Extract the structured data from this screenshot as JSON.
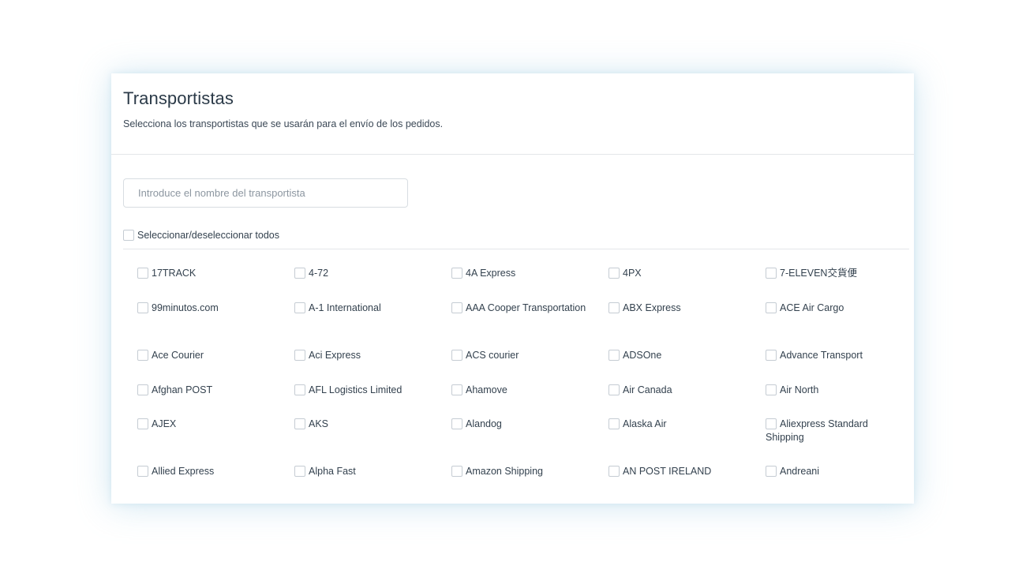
{
  "header": {
    "title": "Transportistas",
    "subtitle": "Selecciona los transportistas que se usarán para el envío de los pedidos."
  },
  "search": {
    "placeholder": "Introduce el nombre del transportista",
    "value": ""
  },
  "select_all": {
    "label": "Seleccionar/deseleccionar todos",
    "checked": false
  },
  "carriers": [
    "17TRACK",
    "4-72",
    "4A Express",
    "4PX",
    "7-ELEVEN交貨便",
    "99minutos.com",
    "A-1 International",
    "AAA Cooper Transportation",
    "ABX Express",
    "ACE Air Cargo",
    "Ace Courier",
    "Aci Express",
    "ACS courier",
    "ADSOne",
    "Advance Transport",
    "Afghan POST",
    "AFL Logistics Limited",
    "Ahamove",
    "Air Canada",
    "Air North",
    "AJEX",
    "AKS",
    "Alandog",
    "Alaska Air",
    "Aliexpress Standard Shipping",
    "Allied Express",
    "Alpha Fast",
    "Amazon Shipping",
    "AN POST IRELAND",
    "Andreani"
  ]
}
